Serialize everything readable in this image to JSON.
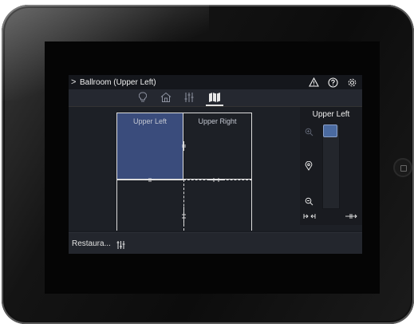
{
  "titlebar": {
    "chevron": ">",
    "title": "Ballroom (Upper Left)",
    "icons": [
      "warning-icon",
      "help-icon",
      "settings-gear-icon"
    ]
  },
  "tabs": [
    {
      "icon": "lightbulb-icon",
      "active": false
    },
    {
      "icon": "home-icon",
      "active": false
    },
    {
      "icon": "sliders-icon",
      "active": false
    },
    {
      "icon": "map-icon",
      "active": true
    }
  ],
  "floorplan": {
    "rooms": [
      {
        "label": "Upper Left",
        "selected": true
      },
      {
        "label": "Upper Right",
        "selected": false
      }
    ]
  },
  "side_panel": {
    "title": "Upper Left",
    "icons": [
      "zoom-in-icon",
      "location-pin-icon",
      "zoom-out-icon",
      "collapse-icon",
      "expand-icon"
    ]
  },
  "bottombar": {
    "label": "Restaura...",
    "icon": "sliders-icon"
  },
  "colors": {
    "selected_room": "#3a4c7c",
    "app_background": "#1a1d23",
    "thumb": "#4a6aa0"
  }
}
